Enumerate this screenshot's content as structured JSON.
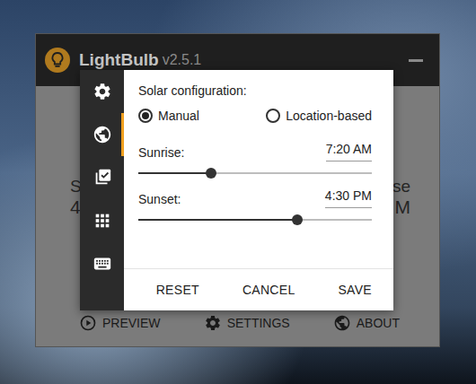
{
  "window": {
    "title": "LightBulb",
    "version": "v2.5.1"
  },
  "background": {
    "sunrise_label": "S",
    "sunrise_time": "4:",
    "sunset_label": "se",
    "sunset_time": "M"
  },
  "toolbar": [
    {
      "label": "PREVIEW"
    },
    {
      "label": "SETTINGS"
    },
    {
      "label": "ABOUT"
    }
  ],
  "dialog": {
    "sidebar": [
      {
        "selected": false
      },
      {
        "selected": true
      },
      {
        "selected": false
      },
      {
        "selected": false
      },
      {
        "selected": false
      }
    ],
    "section_title": "Solar configuration:",
    "modes": [
      {
        "label": "Manual",
        "selected": true
      },
      {
        "label": "Location-based",
        "selected": false
      }
    ],
    "times": [
      {
        "label": "Sunrise:",
        "value": "7:20 AM",
        "level": 0.31
      },
      {
        "label": "Sunset:",
        "value": "4:30 PM",
        "level": 0.68
      }
    ],
    "buttons": [
      "RESET",
      "CANCEL",
      "SAVE"
    ]
  }
}
